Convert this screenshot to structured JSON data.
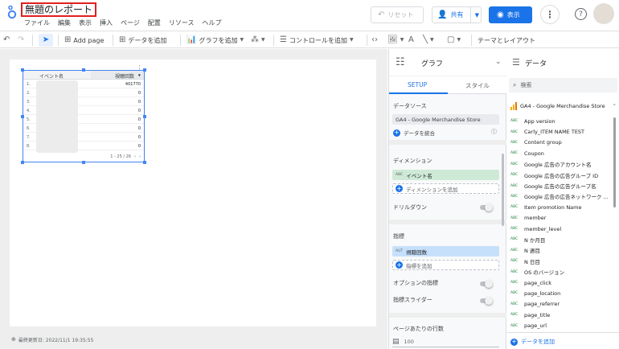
{
  "header": {
    "title": "無題のレポート",
    "menu": [
      "ファイル",
      "編集",
      "表示",
      "挿入",
      "ページ",
      "配置",
      "リソース",
      "ヘルプ"
    ],
    "reset_label": "リセット",
    "share_label": "共有",
    "view_label": "表示"
  },
  "toolbar": {
    "add_page": "Add page",
    "add_data": "データを追加",
    "add_chart": "グラフを追加",
    "add_control": "コントロールを追加",
    "theme_layout": "テーマとレイアウト"
  },
  "canvas": {
    "table": {
      "col_dimension": "イベント名",
      "col_metric": "視聴回数",
      "sort_indicator": "▼",
      "rows": [
        {
          "num": "1.",
          "value": "401770"
        },
        {
          "num": "2.",
          "value": "0"
        },
        {
          "num": "3.",
          "value": "0"
        },
        {
          "num": "4.",
          "value": "0"
        },
        {
          "num": "5.",
          "value": "0"
        },
        {
          "num": "6.",
          "value": "0"
        },
        {
          "num": "7.",
          "value": "0"
        },
        {
          "num": "8.",
          "value": "0"
        }
      ],
      "pagination": "1 - 25 / 26"
    },
    "last_updated": "最終更新日: 2022/11/1 19:35:55"
  },
  "props": {
    "chart_type": "グラフ",
    "tab_setup": "SETUP",
    "tab_style": "スタイル",
    "datasource_label": "データソース",
    "datasource_value": "GA4 - Google Merchandise Store",
    "blend_label": "データを統合",
    "dimension_label": "ディメンション",
    "dimension_value": "イベント名",
    "dimension_type": "ABC",
    "add_dimension": "ディメンションを追加",
    "drilldown_label": "ドリルダウン",
    "metric_label": "指標",
    "metric_value": "視聴回数",
    "metric_type": "AUT",
    "add_metric": "指標を追加",
    "optional_metrics": "オプションの指標",
    "metric_slider": "指標スライダー",
    "rows_per_page": "ページあたりの行数",
    "rows_per_page_value": "100"
  },
  "datapanel": {
    "title": "データ",
    "search_placeholder": "検索",
    "source_name": "GA4 - Google Merchandise Store",
    "fields": [
      "App version",
      "Carly_ITEM NAME TEST",
      "Content group",
      "Coupon",
      "Google 広告のアカウント名",
      "Google 広告の広告グループ ID",
      "Google 広告の広告グループ名",
      "Google 広告の広告ネットワーク ...",
      "Item promotion Name",
      "member",
      "member_level",
      "N か月目",
      "N 週目",
      "N 日目",
      "OS のバージョン",
      "page_click",
      "page_location",
      "page_referrer",
      "page_title",
      "page_url"
    ],
    "field_type": "ABC",
    "add_data": "データを追加"
  },
  "colors": {
    "accent": "#1a73e8",
    "title_outline": "#e01f1f",
    "dimension_chip": "#ceead6",
    "metric_chip": "#c6e0fb"
  }
}
